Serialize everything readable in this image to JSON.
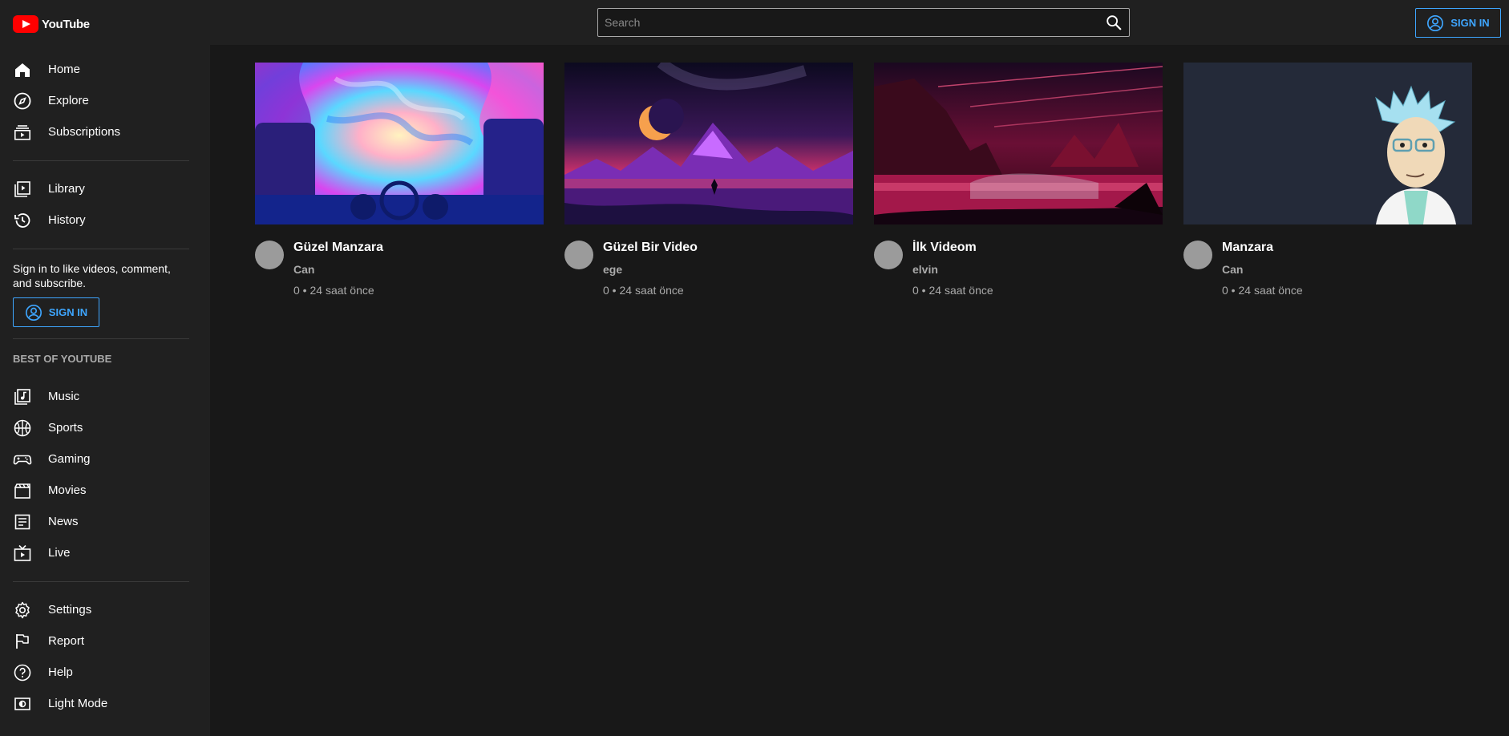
{
  "header": {
    "logo_text": "YouTube",
    "search_placeholder": "Search",
    "signin_label": "SIGN IN"
  },
  "sidebar": {
    "primary": [
      {
        "label": "Home",
        "icon": "home-icon"
      },
      {
        "label": "Explore",
        "icon": "compass-icon"
      },
      {
        "label": "Subscriptions",
        "icon": "subscriptions-icon"
      }
    ],
    "library": [
      {
        "label": "Library",
        "icon": "library-icon"
      },
      {
        "label": "History",
        "icon": "history-icon"
      }
    ],
    "signin_prompt": "Sign in to like videos, comment, and subscribe.",
    "signin_label": "SIGN IN",
    "best_of_title": "BEST OF YOUTUBE",
    "best_of": [
      {
        "label": "Music",
        "icon": "music-icon"
      },
      {
        "label": "Sports",
        "icon": "sports-icon"
      },
      {
        "label": "Gaming",
        "icon": "gaming-icon"
      },
      {
        "label": "Movies",
        "icon": "movies-icon"
      },
      {
        "label": "News",
        "icon": "news-icon"
      },
      {
        "label": "Live",
        "icon": "live-icon"
      }
    ],
    "settings": [
      {
        "label": "Settings",
        "icon": "gear-icon"
      },
      {
        "label": "Report",
        "icon": "flag-icon"
      },
      {
        "label": "Help",
        "icon": "help-icon"
      },
      {
        "label": "Light Mode",
        "icon": "light-mode-icon"
      }
    ]
  },
  "videos": [
    {
      "title": "Güzel Manzara",
      "channel": "Can",
      "views": "0",
      "time": "24 saat önce",
      "thumbnail": "psychedelic-car-thumbnail"
    },
    {
      "title": "Güzel Bir Video",
      "channel": "ege",
      "views": "0",
      "time": "24 saat önce",
      "thumbnail": "purple-mountain-moon-thumbnail"
    },
    {
      "title": "İlk Videom",
      "channel": "elvin",
      "views": "0",
      "time": "24 saat önce",
      "thumbnail": "red-landscape-thumbnail"
    },
    {
      "title": "Manzara",
      "channel": "Can",
      "views": "0",
      "time": "24 saat önce",
      "thumbnail": "cartoon-scientist-thumbnail"
    }
  ],
  "colors": {
    "background": "#181818",
    "surface": "#202020",
    "accent": "#3ea6ff",
    "brand": "#ff0000",
    "secondary_text": "#aaaaaa"
  }
}
